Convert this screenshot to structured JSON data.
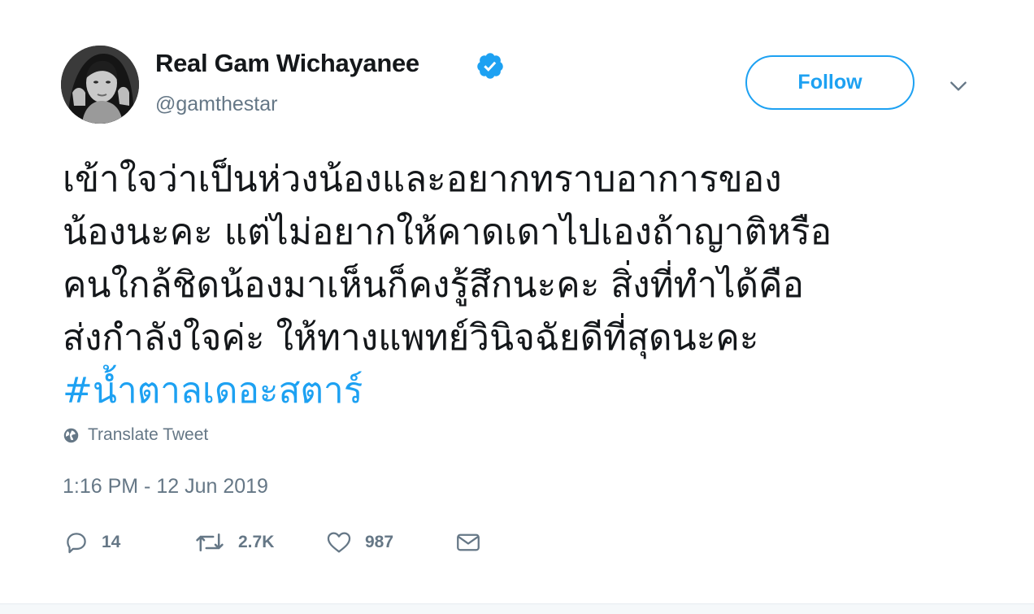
{
  "user": {
    "display_name": "Real Gam Wichayanee",
    "handle": "@gamthestar",
    "verified": true
  },
  "follow_button": {
    "label": "Follow"
  },
  "tweet": {
    "lines": [
      "เข้าใจว่าเป็นห่วงน้องและอยากทราบอาการของ",
      "น้องนะคะ แต่ไม่อยากให้คาดเดาไปเองถ้าญาติหรือ",
      "คนใกล้ชิดน้องมาเห็นก็คงรู้สึกนะคะ สิ่งที่ทำได้คือ",
      "ส่งกำลังใจค่ะ ให้ทางแพทย์วินิจฉัยดีที่สุดนะคะ"
    ],
    "hashtag": "#น้ำตาลเดอะสตาร์"
  },
  "translate": {
    "label": "Translate Tweet"
  },
  "timestamp": "1:16 PM - 12 Jun 2019",
  "actions": {
    "reply": {
      "icon": "reply-icon",
      "count": "14"
    },
    "retweet": {
      "icon": "retweet-icon",
      "count": "2.7K"
    },
    "like": {
      "icon": "heart-icon",
      "count": "987"
    },
    "dm": {
      "icon": "envelope-icon"
    }
  },
  "colors": {
    "accent": "#1da1f2",
    "text": "#14171a",
    "secondary": "#657786"
  }
}
